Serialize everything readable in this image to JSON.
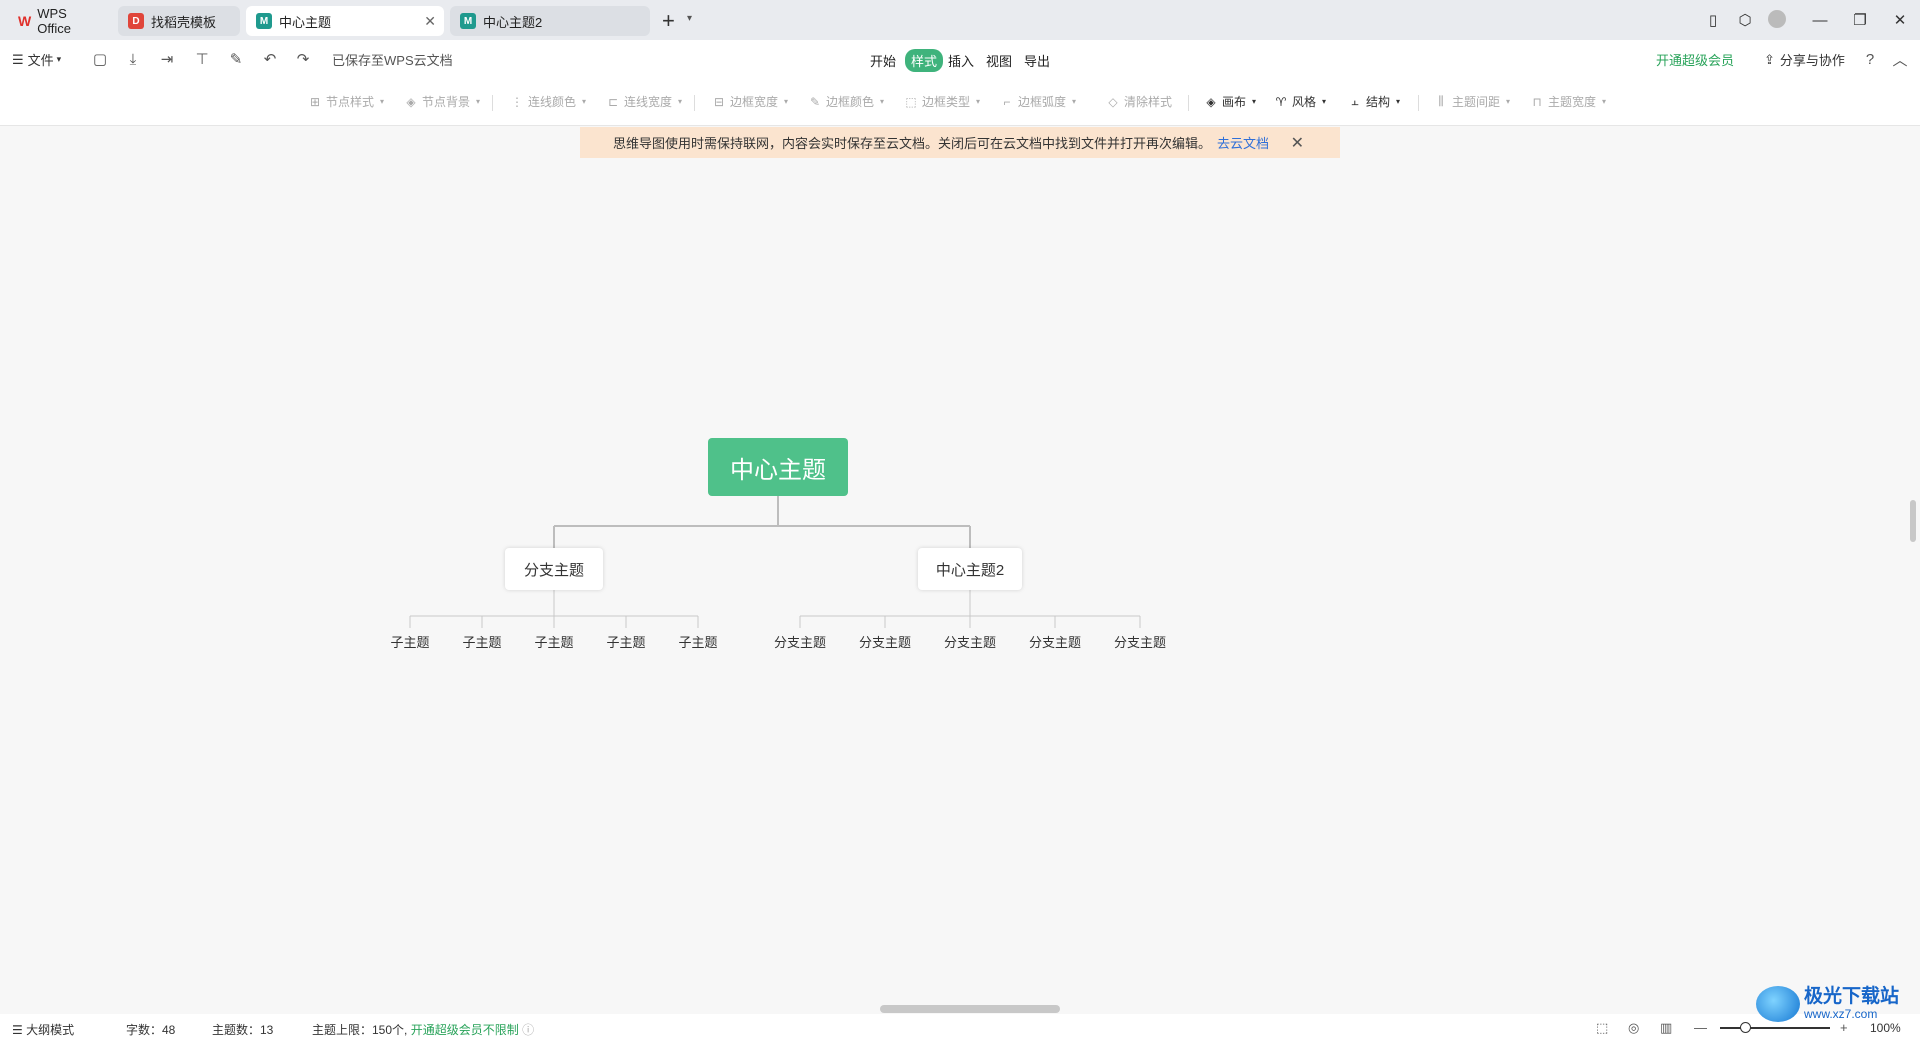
{
  "tabs": [
    {
      "label": "WPS Office"
    },
    {
      "label": "找稻壳模板"
    },
    {
      "label": "中心主题"
    },
    {
      "label": "中心主题2"
    }
  ],
  "toolbar": {
    "file_label": "文件",
    "saved_status": "已保存至WPS云文档",
    "menu_tabs": [
      "开始",
      "样式",
      "插入",
      "视图",
      "导出"
    ],
    "vip_label": "开通超级会员",
    "share_label": "分享与协作",
    "help_label": "?"
  },
  "stylebar": {
    "items": [
      "节点样式",
      "节点背景",
      "连线颜色",
      "连线宽度",
      "边框宽度",
      "边框颜色",
      "边框类型",
      "边框弧度",
      "清除样式",
      "画布",
      "风格",
      "结构",
      "主题间距",
      "主题宽度"
    ]
  },
  "notice": {
    "text": "思维导图使用时需保持联网，内容会实时保存至云文档。关闭后可在云文档中找到文件并打开再次编辑。",
    "link": "去云文档"
  },
  "mindmap": {
    "center": "中心主题",
    "branches": [
      {
        "label": "分支主题",
        "children": [
          "子主题",
          "子主题",
          "子主题",
          "子主题",
          "子主题"
        ]
      },
      {
        "label": "中心主题2",
        "children": [
          "分支主题",
          "分支主题",
          "分支主题",
          "分支主题",
          "分支主题"
        ]
      }
    ]
  },
  "statusbar": {
    "outline_mode": "大纲模式",
    "word_count": "字数：48",
    "topic_count": "主题数：13",
    "topic_limit": "主题上限：150个,",
    "vip_unlimited": "开通超级会员不限制",
    "zoom": "100%"
  },
  "watermark": {
    "title": "极光下载站",
    "url": "www.xz7.com"
  }
}
